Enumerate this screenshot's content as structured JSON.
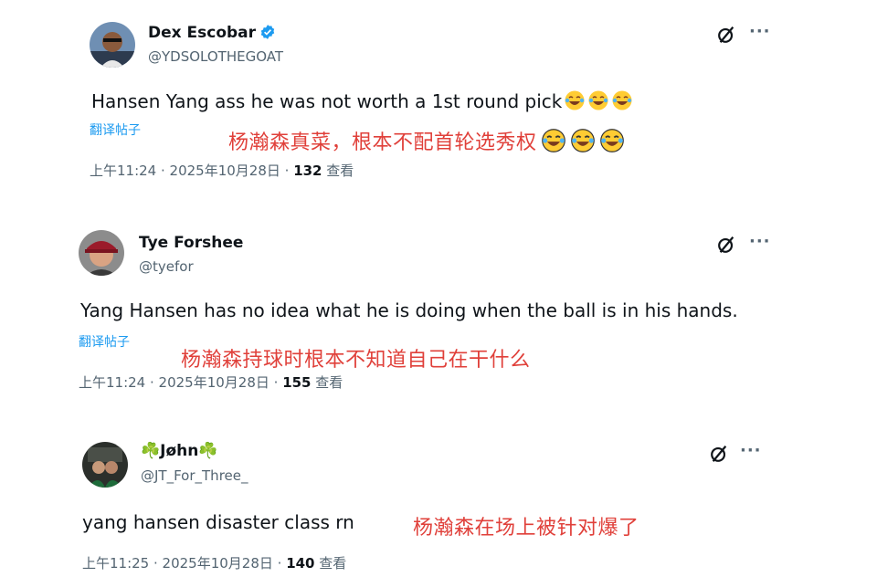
{
  "tweets": [
    {
      "name": "Dex Escobar",
      "handle": "@YDSOLOTHEGOAT",
      "verified": true,
      "text": "Hansen Yang ass he was not worth a 1st round pick",
      "translate_label": "翻译帖子",
      "caption": "杨瀚森真菜，根本不配首轮选秀权",
      "time": "上午11:24 · 2025年10月28日 · ",
      "views": "132",
      "views_label": " 查看"
    },
    {
      "name": "Tye Forshee",
      "handle": "@tyefor",
      "text": "Yang Hansen has no idea what he is doing when the ball is in his hands.",
      "translate_label": "翻译帖子",
      "caption": "杨瀚森持球时根本不知道自己在干什么",
      "time": "上午11:24 · 2025年10月28日 · ",
      "views": "155",
      "views_label": " 查看"
    },
    {
      "name": "Jøhn",
      "name_prefix": "☘️",
      "name_suffix": "☘️",
      "handle": "@JT_For_Three_",
      "text": "yang hansen disaster class rn",
      "caption": "杨瀚森在场上被针对爆了",
      "time": "上午11:25 · 2025年10月28日 · ",
      "views": "140",
      "views_label": " 查看"
    }
  ],
  "icons": {
    "more": "more-options-icon",
    "grok": "grok-icon",
    "verified": "verified-badge-icon",
    "laugh": "face-with-tears-of-joy-icon"
  },
  "colors": {
    "caption": "#e0403a",
    "link": "#1d9bf0",
    "secondary": "#536471",
    "verified": "#1d9bf0"
  },
  "more_glyph": "···"
}
